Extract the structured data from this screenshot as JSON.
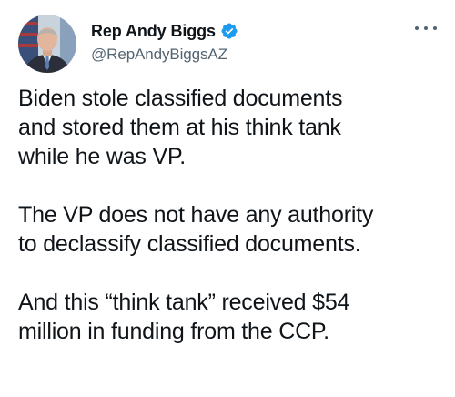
{
  "author": {
    "display_name": "Rep Andy Biggs",
    "handle": "@RepAndyBiggsAZ",
    "verified": true,
    "avatar_icon": "profile-photo"
  },
  "menu": {
    "icon": "more-horizontal-icon"
  },
  "tweet": {
    "paragraphs": [
      "Biden stole classified documents\nand stored them at his think tank\nwhile he was VP.",
      "The VP does not have any authority\nto declassify classified documents.",
      "And this “think tank” received $54\nmillion in funding from the CCP."
    ]
  },
  "colors": {
    "text": "#0f1419",
    "secondary_text": "#536471",
    "verified_badge": "#1d9bf0",
    "background": "#ffffff"
  }
}
